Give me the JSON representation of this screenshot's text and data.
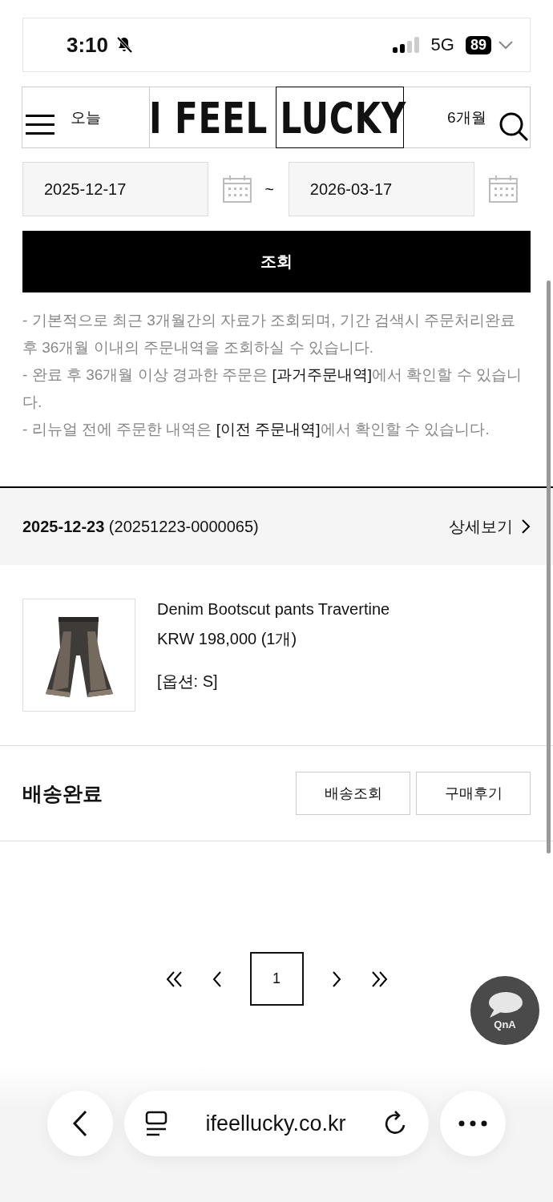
{
  "status_bar": {
    "time": "3:10",
    "network": "5G",
    "battery": "89"
  },
  "tabs": [
    {
      "label": "오늘",
      "selected": false
    },
    {
      "selected": false
    },
    {
      "selected": true
    },
    {
      "label": "6개월",
      "selected": false
    }
  ],
  "logo": "I FEEL LUCKY",
  "date_range": {
    "start": "2025-12-17",
    "separator": "~",
    "end": "2026-03-17"
  },
  "search_button": "조회",
  "notes": [
    "- 기본적으로 최근 3개월간의 자료가 조회되며, 기간 검색시 주문처리완료 후 36개월 이내의 주문내역을 조회하실 수 있습니다.",
    "- 완료 후 36개월 이상 경과한 주문은 **[과거주문내역]**에서 확인할 수 있습니다.",
    "- 리뉴얼 전에 주문한 내역은 **[이전 주문내역]**에서 확인할 수 있습니다."
  ],
  "orders": [
    {
      "date": "2025-12-23",
      "number": "(20251223-0000065)",
      "detail_link": "상세보기",
      "product": {
        "kind": "picture",
        "name": "Denim Bootscut pants Travertine",
        "price": "KRW 198,000 (1개)",
        "option": "[옵션: S]"
      },
      "status": "배송완료",
      "actions": [
        "배송조회",
        "구매후기"
      ]
    }
  ],
  "pagination": {
    "pages": [
      {
        "label": "1",
        "selected": true
      }
    ]
  },
  "qna_button": "QnA",
  "browser": {
    "url": "ifeellucky.co.kr"
  }
}
